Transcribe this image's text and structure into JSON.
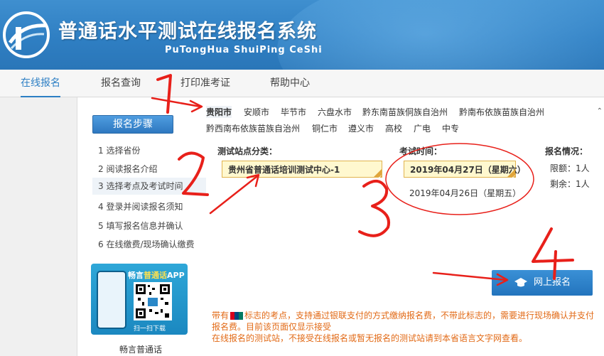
{
  "header": {
    "title": "普通话水平测试在线报名系统",
    "subtitle": "PuTongHua ShuiPing CeShi"
  },
  "nav": {
    "items": [
      {
        "label": "在线报名",
        "active": true
      },
      {
        "label": "报名查询",
        "active": false
      },
      {
        "label": "打印准考证",
        "active": false
      },
      {
        "label": "帮助中心",
        "active": false
      }
    ]
  },
  "steps": {
    "button_label": "报名步骤",
    "items": [
      {
        "label": "1 选择省份"
      },
      {
        "label": "2 阅读报名介绍"
      },
      {
        "label": "3 选择考点及考试时间"
      },
      {
        "label": "4 登录并阅读报名须知"
      },
      {
        "label": "5 填写报名信息并确认"
      },
      {
        "label": "6 在线缴费/现场确认缴费"
      }
    ],
    "current_index": 2
  },
  "app": {
    "name_prefix": "畅言",
    "name_highlight": "普通话",
    "name_suffix": "APP",
    "scan_tip": "扫一扫下载",
    "caption": "畅言普通话"
  },
  "cities": {
    "items": [
      "贵阳市",
      "安顺市",
      "毕节市",
      "六盘水市",
      "黔东南苗族侗族自治州",
      "黔南布依族苗族自治州",
      "黔西南布依族苗族自治州",
      "铜仁市",
      "遵义市",
      "高校",
      "广电",
      "中专"
    ],
    "selected": "贵阳市"
  },
  "form": {
    "site_label": "测试站点分类：",
    "site_value": "贵州省普通话培训测试中心-1",
    "time_label": "考试时间：",
    "time_selected": "2019年04月27日（星期六）",
    "time_other": "2019年04月26日（星期五）",
    "status_label": "报名情况：",
    "limit": "限额：1人",
    "remaining": "剩余：1人",
    "apply_button": "网上报名"
  },
  "notice": {
    "part1": "带有",
    "part2": "标志的考点，支持通过银联支付的方式缴纳报名费，不带此标志的，需要进行现场确认并支付报名费。目前该页面仅显示接受",
    "line2": "在线报名的测试站，不接受在线报名或暂无报名的测试站请到本省语言文字网查看。"
  },
  "annotations": {
    "numbers": [
      "1",
      "2",
      "3",
      "4"
    ],
    "color": "#e8201a"
  },
  "colors": {
    "brand_blue": "#2d7fc4",
    "notice_orange": "#e26a16",
    "select_yellow": "#fff8cf"
  }
}
